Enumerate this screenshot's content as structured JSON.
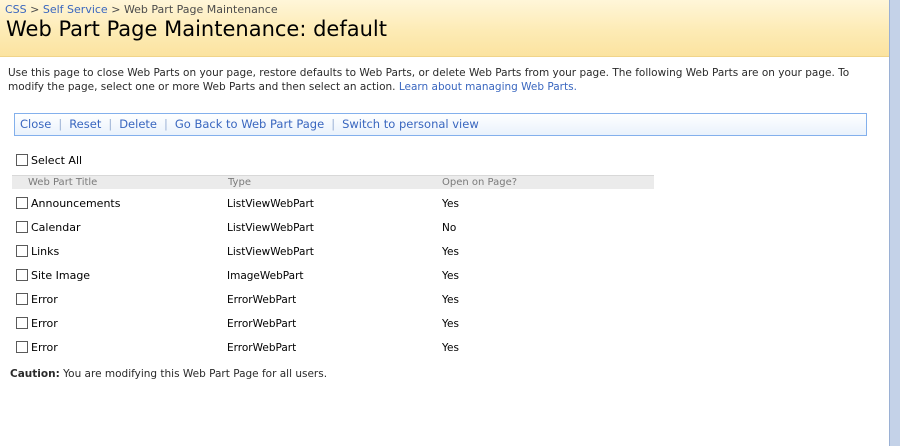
{
  "breadcrumb": {
    "items": [
      "CSS",
      "Self Service",
      "Web Part Page Maintenance"
    ],
    "separator": ">"
  },
  "page_title": "Web Part Page Maintenance: default",
  "description": {
    "text": "Use this page to close Web Parts on your page, restore defaults to Web Parts, or delete Web Parts from your page. The following Web Parts are on your page. To modify the page, select one or more Web Parts and then select an action.",
    "link": "Learn about managing Web Parts."
  },
  "toolbar": {
    "close": "Close",
    "reset": "Reset",
    "delete": "Delete",
    "go_back": "Go Back to Web Part Page",
    "switch": "Switch to personal view",
    "separator": "|"
  },
  "select_all": "Select All",
  "table": {
    "headers": [
      "Web Part Title",
      "Type",
      "Open on Page?"
    ],
    "rows": [
      {
        "title": "Announcements",
        "type": "ListViewWebPart",
        "open": "Yes"
      },
      {
        "title": "Calendar",
        "type": "ListViewWebPart",
        "open": "No"
      },
      {
        "title": "Links",
        "type": "ListViewWebPart",
        "open": "Yes"
      },
      {
        "title": "Site Image",
        "type": "ImageWebPart",
        "open": "Yes"
      },
      {
        "title": "Error",
        "type": "ErrorWebPart",
        "open": "Yes"
      },
      {
        "title": "Error",
        "type": "ErrorWebPart",
        "open": "Yes"
      },
      {
        "title": "Error",
        "type": "ErrorWebPart",
        "open": "Yes"
      }
    ]
  },
  "caution": {
    "label": "Caution:",
    "text": "You are modifying this Web Part Page for all users."
  },
  "colors": {
    "link": "#3966bf",
    "header_bg": "#fdebb5",
    "toolbar_border": "#83b0ec"
  }
}
